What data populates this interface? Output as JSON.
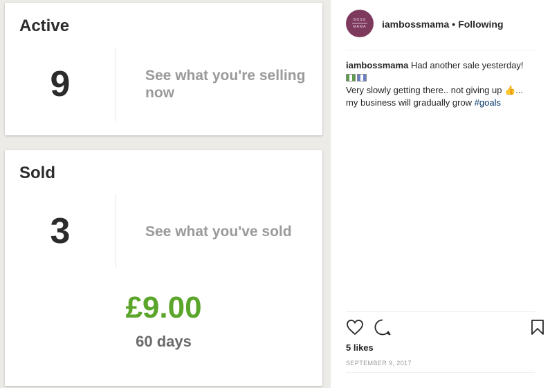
{
  "active_card": {
    "title": "Active",
    "count": "9",
    "link_text": "See what you're selling now"
  },
  "sold_card": {
    "title": "Sold",
    "count": "3",
    "link_text": "See what you've sold",
    "amount": "£9.00",
    "period": "60 days"
  },
  "post": {
    "avatar_line1": "BOSS",
    "avatar_line2": "MAMA",
    "username": "iambossmama",
    "separator": "•",
    "follow_status": "Following",
    "caption_username": "iambossmama",
    "caption_line1": " Had another sale yesterday!",
    "caption_line2": "Very slowly getting there.. not giving up 👍...",
    "caption_line3": "my business will gradually grow ",
    "hashtag": "#goals",
    "likes": "5 likes",
    "date": "SEPTEMBER 9, 2017"
  },
  "icons": {
    "like": "heart-icon",
    "comment": "comment-icon",
    "save": "bookmark-icon"
  },
  "colors": {
    "amount_green": "#5aa52a",
    "hashtag_blue": "#003569",
    "avatar_bg": "#7d3a5d"
  }
}
